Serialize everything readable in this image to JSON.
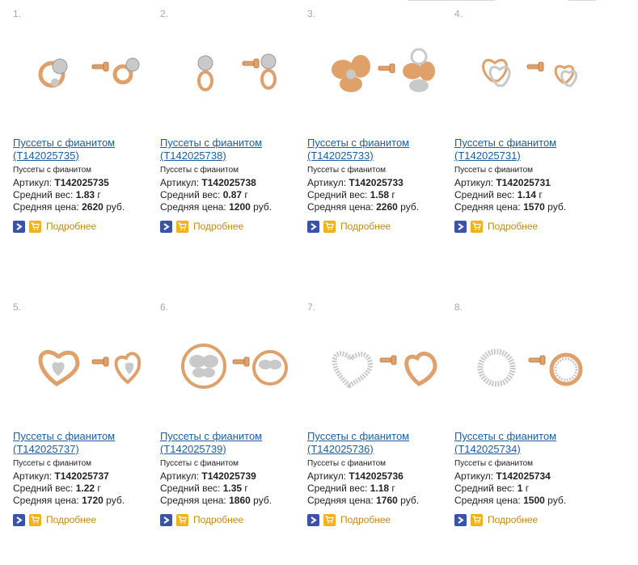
{
  "product_list": {
    "more_label": "Подробнее",
    "colors": {
      "link": "#1a5fa8",
      "more": "#c58a16",
      "arrow_icon_bg": "#3a53a8",
      "cart_icon_bg": "#f2b21a",
      "gold": "#e0a06a",
      "silver": "#c9c9c9"
    },
    "items": [
      {
        "num": "1.",
        "title_line1": "Пуссеты с фианитом",
        "title_line2": "(T142025735)",
        "subtitle": "Пуссеты с фианитом",
        "article_label": "Артикул:",
        "article": "T142025735",
        "weight_label": "Средний вес:",
        "weight": "1.83",
        "weight_unit": "г",
        "price_label": "Средняя цена:",
        "price": "2620",
        "price_unit": "руб.",
        "shape": "flower-loop"
      },
      {
        "num": "2.",
        "title_line1": "Пуссеты с фианитом",
        "title_line2": "(T142025738)",
        "subtitle": "Пуссеты с фианитом",
        "article_label": "Артикул:",
        "article": "T142025738",
        "weight_label": "Средний вес:",
        "weight": "0.87",
        "weight_unit": "г",
        "price_label": "Средняя цена:",
        "price": "1200",
        "price_unit": "руб.",
        "shape": "flower-drop"
      },
      {
        "num": "3.",
        "title_line1": "Пуссеты с фианитом",
        "title_line2": "(T142025733)",
        "subtitle": "Пуссеты с фианитом",
        "article_label": "Артикул:",
        "article": "T142025733",
        "weight_label": "Средний вес:",
        "weight": "1.58",
        "weight_unit": "г",
        "price_label": "Средняя цена:",
        "price": "2260",
        "price_unit": "руб.",
        "shape": "clover"
      },
      {
        "num": "4.",
        "title_line1": "Пуссеты с фианитом",
        "title_line2": "(T142025731)",
        "subtitle": "Пуссеты с фианитом",
        "article_label": "Артикул:",
        "article": "T142025731",
        "weight_label": "Средний вес:",
        "weight": "1.14",
        "weight_unit": "г",
        "price_label": "Средняя цена:",
        "price": "1570",
        "price_unit": "руб.",
        "shape": "double-heart"
      },
      {
        "num": "5.",
        "title_line1": "Пуссеты с фианитом",
        "title_line2": "(T142025737)",
        "subtitle": "Пуссеты с фианитом",
        "article_label": "Артикул:",
        "article": "T142025737",
        "weight_label": "Средний вес:",
        "weight": "1.22",
        "weight_unit": "г",
        "price_label": "Средняя цена:",
        "price": "1720",
        "price_unit": "руб.",
        "shape": "heart-inner"
      },
      {
        "num": "6.",
        "title_line1": "Пуссеты с фианитом",
        "title_line2": "(T142025739)",
        "subtitle": "Пуссеты с фианитом",
        "article_label": "Артикул:",
        "article": "T142025739",
        "weight_label": "Средний вес:",
        "weight": "1.35",
        "weight_unit": "г",
        "price_label": "Средняя цена:",
        "price": "1860",
        "price_unit": "руб.",
        "shape": "butterfly-ring"
      },
      {
        "num": "7.",
        "title_line1": "Пуссеты с фианитом",
        "title_line2": "(T142025736)",
        "subtitle": "Пуссеты с фианитом",
        "article_label": "Артикул:",
        "article": "T142025736",
        "weight_label": "Средний вес:",
        "weight": "1.18",
        "weight_unit": "г",
        "price_label": "Средняя цена:",
        "price": "1760",
        "price_unit": "руб.",
        "shape": "open-heart"
      },
      {
        "num": "8.",
        "title_line1": "Пуссеты с фианитом",
        "title_line2": "(T142025734)",
        "subtitle": "Пуссеты с фианитом",
        "article_label": "Артикул:",
        "article": "T142025734",
        "weight_label": "Средний вес:",
        "weight": "1",
        "weight_unit": "г",
        "price_label": "Средняя цена:",
        "price": "1500",
        "price_unit": "руб.",
        "shape": "circle"
      }
    ]
  }
}
